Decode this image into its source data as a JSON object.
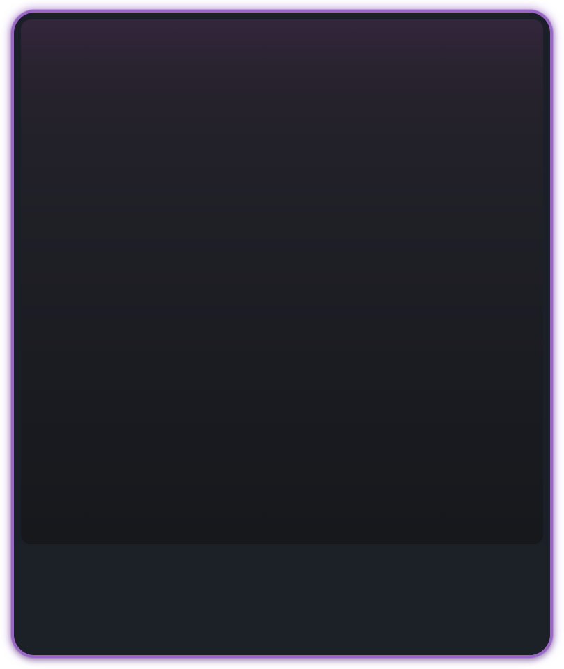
{
  "card": {
    "accent_color": "#9a67c9",
    "background_color": "#1b1f27"
  },
  "panel": {
    "gradient_top_color": "#33263d",
    "gradient_bottom_color": "#16181c"
  },
  "footer": {
    "background_color": "#1c2027"
  }
}
